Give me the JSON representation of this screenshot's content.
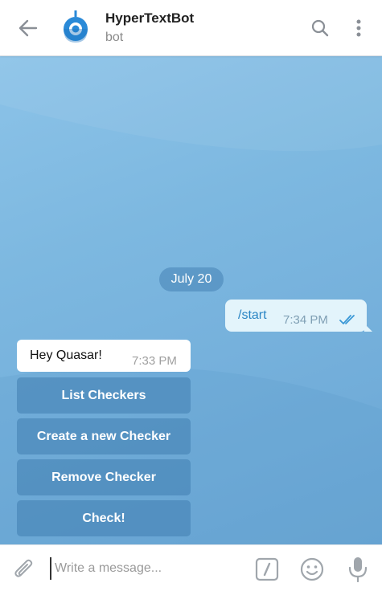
{
  "header": {
    "title": "HyperTextBot",
    "subtitle": "bot",
    "icons": [
      "back-arrow-icon",
      "bot-avatar-icon",
      "search-icon",
      "more-vertical-icon"
    ]
  },
  "chat": {
    "date_label": "July 20",
    "messages": [
      {
        "direction": "outgoing",
        "text": "/start",
        "time": "7:34 PM",
        "status": "read"
      },
      {
        "direction": "incoming",
        "text": "Hey Quasar!",
        "time": "7:33 PM"
      }
    ],
    "keyboard_buttons": [
      {
        "label": "List Checkers"
      },
      {
        "label": "Create a new Checker"
      },
      {
        "label": "Remove Checker"
      },
      {
        "label": "Check!"
      }
    ]
  },
  "composer": {
    "placeholder": "Write a message...",
    "icons": [
      "attach-icon",
      "command-icon",
      "emoji-icon",
      "microphone-icon"
    ]
  },
  "colors": {
    "accent": "#2a85c4",
    "chat_bg": "#7db8e0",
    "outgoing_bubble": "#e3f4fb"
  }
}
